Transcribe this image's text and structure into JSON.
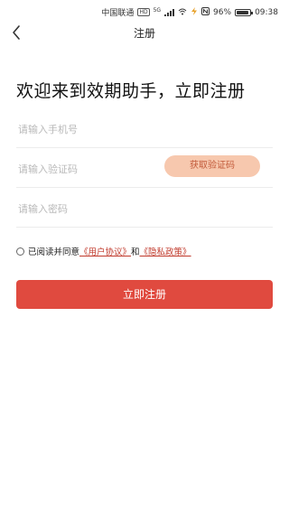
{
  "status_bar": {
    "carrier": "中国联通",
    "hd": "HD",
    "network": "5G",
    "battery_percent": "96%",
    "time": "09:38"
  },
  "nav": {
    "title": "注册"
  },
  "welcome": "欢迎来到效期助手，立即注册",
  "form": {
    "phone_placeholder": "请输入手机号",
    "code_placeholder": "请输入验证码",
    "get_code_label": "获取验证码",
    "password_placeholder": "请输入密码"
  },
  "agreement": {
    "prefix": "已阅读并同意",
    "user_agreement": "《用户协议》",
    "conjunction": "和",
    "privacy_policy": "《隐私政策》"
  },
  "submit_label": "立即注册",
  "colors": {
    "primary": "#e04a3f",
    "code_button_bg": "#f7c8ae",
    "link": "#c0392b"
  }
}
